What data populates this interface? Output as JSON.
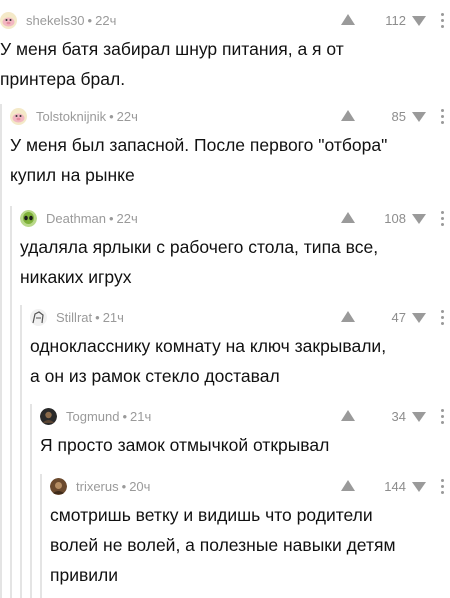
{
  "comments": [
    {
      "author": "shekels30",
      "time": "22ч",
      "rating": "112",
      "avatar_icon": "pig-avatar-icon",
      "text": "У меня батя забирал шнур питания, а я от\nпринтера брал."
    },
    {
      "author": "Tolstoknijnik",
      "time": "22ч",
      "rating": "85",
      "avatar_icon": "pig-avatar-icon",
      "text": "У меня был запасной. После первого \"отбора\"\nкупил на рынке"
    },
    {
      "author": "Deathman",
      "time": "22ч",
      "rating": "108",
      "avatar_icon": "alien-avatar-icon",
      "text": "удаляла ярлыки с рабочего стола, типа все,\nникаких игрух"
    },
    {
      "author": "Stillrat",
      "time": "21ч",
      "rating": "47",
      "avatar_icon": "sketch-avatar-icon",
      "text": "однокласснику комнату на ключ закрывали,\nа он из рамок стекло доставал"
    },
    {
      "author": "Togmund",
      "time": "21ч",
      "rating": "34",
      "avatar_icon": "dark-avatar-icon",
      "text": "Я просто замок отмычкой открывал"
    },
    {
      "author": "trixerus",
      "time": "20ч",
      "rating": "144",
      "avatar_icon": "brown-avatar-icon",
      "text": "смотришь ветку и видишь что родители\nволей не волей, а полезные навыки детям\nпривили"
    }
  ],
  "colors": {
    "meta_text": "#9a9a9a",
    "body_text": "#111111",
    "branch_line": "#e4e4e4"
  }
}
